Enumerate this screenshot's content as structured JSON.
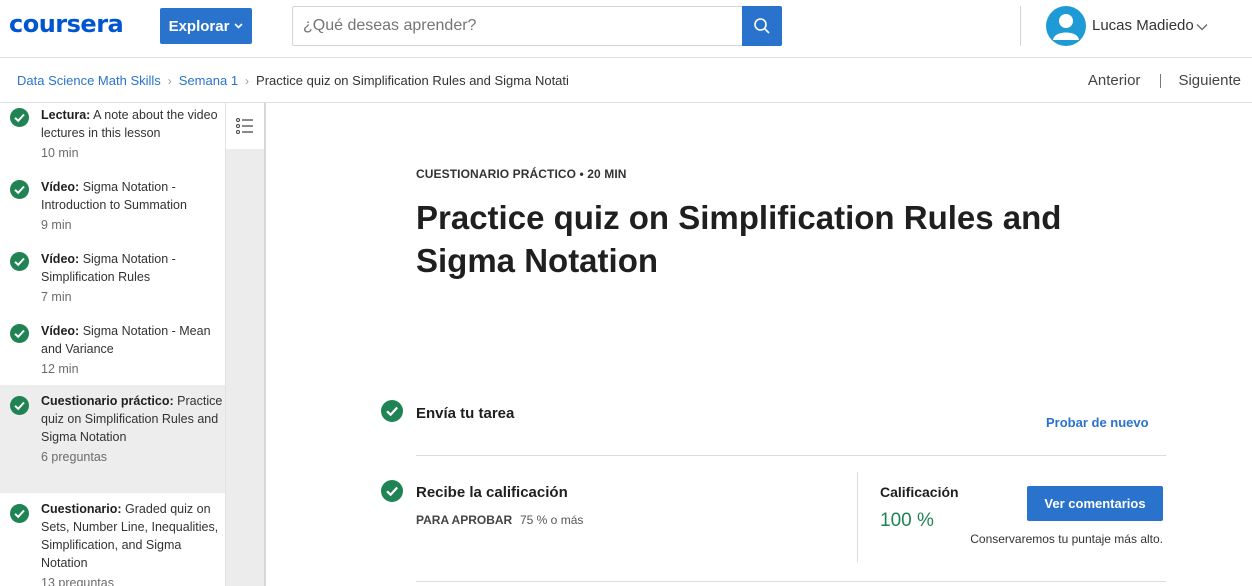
{
  "header": {
    "logo": "coursera",
    "explore_label": "Explorar",
    "search_placeholder": "¿Qué deseas aprender?",
    "user_name": "Lucas Madiedo",
    "accent_color": "#2a73cc"
  },
  "breadcrumb": {
    "course": "Data Science Math Skills",
    "week": "Semana 1",
    "current": "Practice quiz on Simplification Rules and Sigma Notati"
  },
  "nav": {
    "previous": "Anterior",
    "next": "Siguiente"
  },
  "sidebar": {
    "items": [
      {
        "type": "Lectura:",
        "name": "A note about the video lectures in this lesson",
        "meta": "10 min",
        "completed": true
      },
      {
        "type": "Vídeo:",
        "name": "Sigma Notation - Introduction to Summation",
        "meta": "9 min",
        "completed": true
      },
      {
        "type": "Vídeo:",
        "name": "Sigma Notation - Simplification Rules",
        "meta": "7 min",
        "completed": true
      },
      {
        "type": "Vídeo:",
        "name": "Sigma Notation - Mean and Variance",
        "meta": "12 min",
        "completed": true
      },
      {
        "type": "Cuestionario práctico:",
        "name": "Practice quiz on Simplification Rules and Sigma Notation",
        "meta": "6 preguntas",
        "completed": true,
        "active": true
      },
      {
        "type": "Cuestionario:",
        "name": "Graded quiz on Sets, Number Line, Inequalities, Simplification, and Sigma Notation",
        "meta": "13 preguntas",
        "completed": true
      }
    ]
  },
  "main": {
    "eyebrow": "CUESTIONARIO PRÁCTICO • 20 MIN",
    "title": "Practice quiz on Simplification Rules and Sigma Notation",
    "submit_step": "Envía tu tarea",
    "retry_label": "Probar de nuevo",
    "grade_step": "Recibe la calificación",
    "pass_label": "PARA APROBAR",
    "pass_value": "75 % o más",
    "grade_label": "Calificación",
    "grade_value": "100 %",
    "feedback_button": "Ver comentarios",
    "keep_note": "Conservaremos tu puntaje más alto.",
    "success_color": "#1f8354"
  }
}
